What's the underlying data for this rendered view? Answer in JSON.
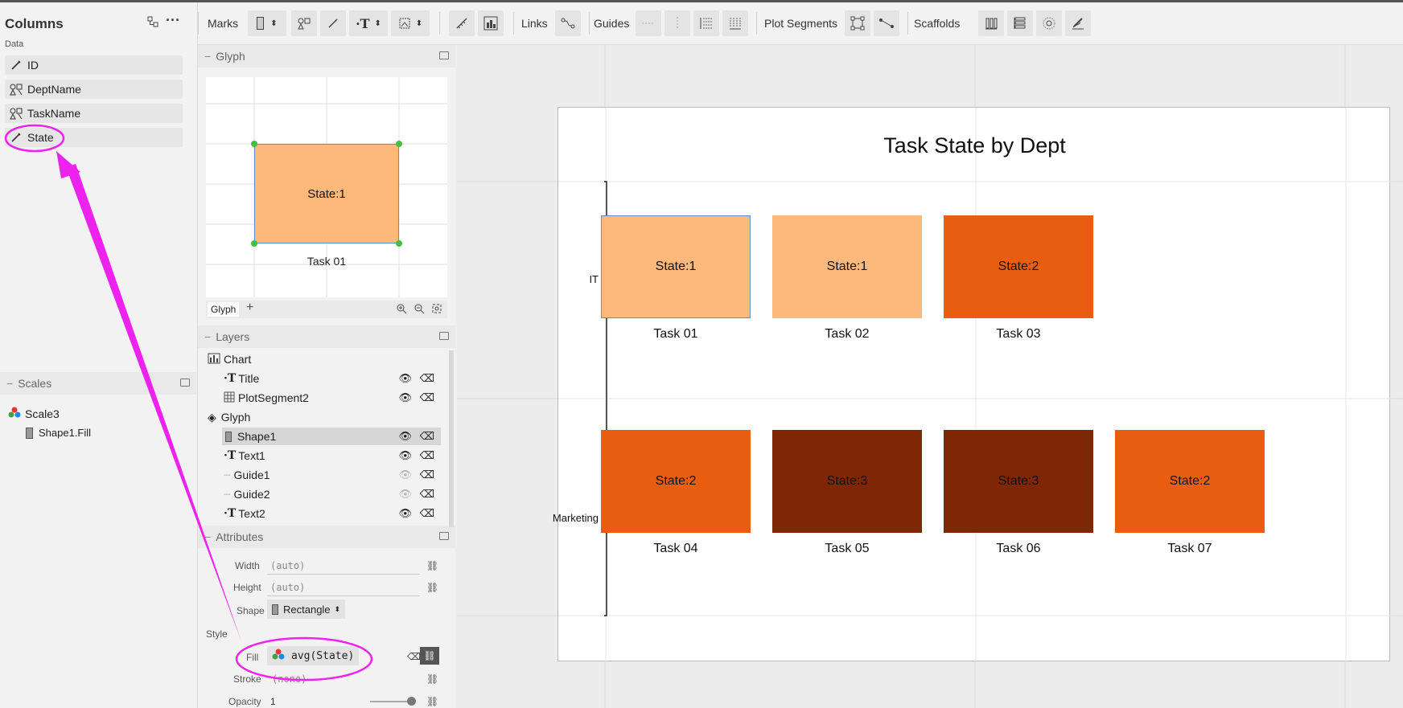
{
  "columns_panel": {
    "title": "Columns",
    "subtitle": "Data",
    "items": [
      {
        "label": "ID",
        "icon": "numeric-column-icon"
      },
      {
        "label": "DeptName",
        "icon": "categorical-column-icon"
      },
      {
        "label": "TaskName",
        "icon": "categorical-column-icon"
      },
      {
        "label": "State",
        "icon": "numeric-column-icon"
      }
    ]
  },
  "scales_panel": {
    "title": "Scales",
    "scale_name": "Scale3",
    "scale_target": "Shape1.Fill"
  },
  "toolbar": {
    "marks_label": "Marks",
    "links_label": "Links",
    "guides_label": "Guides",
    "plot_segments_label": "Plot Segments",
    "scaffolds_label": "Scaffolds"
  },
  "glyph_panel": {
    "title": "Glyph",
    "shape_text": "State:1",
    "task_text": "Task 01",
    "tab_label": "Glyph",
    "add_label": "+"
  },
  "layers_panel": {
    "title": "Layers",
    "items": [
      {
        "label": "Chart",
        "icon": "chart-icon"
      },
      {
        "label": "Title",
        "icon": "text-icon"
      },
      {
        "label": "PlotSegment2",
        "icon": "grid-icon"
      },
      {
        "label": "Glyph",
        "icon": "glyph-icon"
      },
      {
        "label": "Shape1",
        "icon": "rect-icon"
      },
      {
        "label": "Text1",
        "icon": "text-icon"
      },
      {
        "label": "Guide1",
        "icon": "guide-icon"
      },
      {
        "label": "Guide2",
        "icon": "guide-icon"
      },
      {
        "label": "Text2",
        "icon": "text-icon"
      }
    ]
  },
  "attributes_panel": {
    "title": "Attributes",
    "width_label": "Width",
    "width_value": "(auto)",
    "height_label": "Height",
    "height_value": "(auto)",
    "shape_label": "Shape",
    "shape_value": "Rectangle",
    "style_label": "Style",
    "fill_label": "Fill",
    "fill_value": "avg(State)",
    "stroke_label": "Stroke",
    "stroke_value": "(none)",
    "opacity_label": "Opacity",
    "opacity_value": "1"
  },
  "chart": {
    "title": "Task State by Dept",
    "rows": [
      "IT",
      "Marketing"
    ],
    "colors": {
      "state1": "#fdb97c",
      "state2": "#e85d0f",
      "state3": "#7f2704"
    },
    "marks": [
      {
        "label": "State:1",
        "task": "Task 01",
        "state": 1,
        "dept": "IT",
        "col": 0
      },
      {
        "label": "State:1",
        "task": "Task 02",
        "state": 1,
        "dept": "IT",
        "col": 1
      },
      {
        "label": "State:2",
        "task": "Task 03",
        "state": 2,
        "dept": "IT",
        "col": 2
      },
      {
        "label": "State:2",
        "task": "Task 04",
        "state": 2,
        "dept": "Marketing",
        "col": 0
      },
      {
        "label": "State:3",
        "task": "Task 05",
        "state": 3,
        "dept": "Marketing",
        "col": 1
      },
      {
        "label": "State:3",
        "task": "Task 06",
        "state": 3,
        "dept": "Marketing",
        "col": 2
      },
      {
        "label": "State:2",
        "task": "Task 07",
        "state": 2,
        "dept": "Marketing",
        "col": 3
      }
    ]
  },
  "annotation": {
    "color": "#ee22ee"
  }
}
